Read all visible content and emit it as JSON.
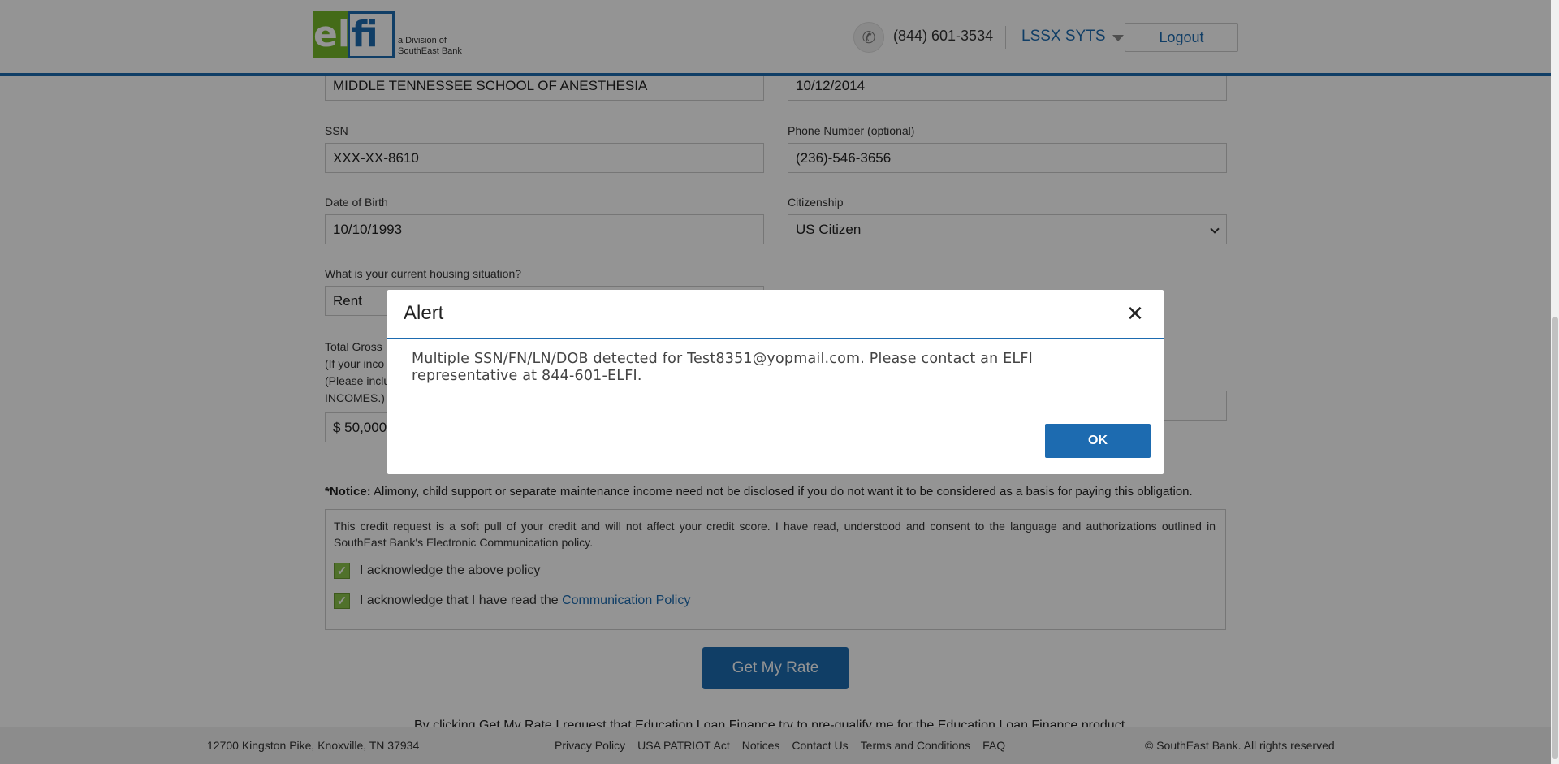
{
  "header": {
    "logo": {
      "part1": "el",
      "part2": "fi",
      "subtitle_line1": "a Division of",
      "subtitle_line2": "SouthEast Bank"
    },
    "phone": "(844) 601-3534",
    "user_name": "LSSX SYTS",
    "logout_label": "Logout"
  },
  "form": {
    "school_value": "MIDDLE TENNESSEE SCHOOL OF ANESTHESIA",
    "date_value": "10/12/2014",
    "ssn_label": "SSN",
    "ssn_value": "XXX-XX-8610",
    "phone_label": "Phone Number (optional)",
    "phone_value": "(236)-546-3656",
    "dob_label": "Date of Birth",
    "dob_value": "10/10/1993",
    "citizenship_label": "Citizenship",
    "citizenship_value": "US Citizen",
    "housing_label": "What is your current housing situation?",
    "housing_value": "Rent",
    "income_label_line1": "Total Gross I",
    "income_label_line2": "(If your inco",
    "income_label_line3": "(Please inclu",
    "income_label_line4": "INCOMES.)",
    "income_value": "$ 50,000"
  },
  "notice": {
    "prefix": "*Notice:",
    "text": " Alimony, child support or separate maintenance income need not be disclosed if you do not want it to be considered as a basis for paying this obligation."
  },
  "policy": {
    "text": "This credit request is a soft pull of your credit and will not affect your credit score. I have read, understood and consent to the language and authorizations outlined in SouthEast Bank's Electronic Communication policy.",
    "ack1": "I acknowledge the above policy",
    "ack2_prefix": "I acknowledge that I have read the",
    "ack2_link": "Communication Policy"
  },
  "get_rate_label": "Get My Rate",
  "disclaimer": "By clicking Get My Rate I request that Education Loan Finance try to pre-qualify me for the Education Loan Finance product",
  "footer": {
    "address": "12700 Kingston Pike, Knoxville, TN 37934",
    "links": [
      "Privacy Policy",
      "USA PATRIOT Act",
      "Notices",
      "Contact Us",
      "Terms and Conditions",
      "FAQ"
    ],
    "copyright": "© SouthEast Bank. All rights reserved"
  },
  "modal": {
    "title": "Alert",
    "close_glyph": "✕",
    "message": "Multiple SSN/FN/LN/DOB detected for Test8351@yopmail.com. Please contact an ELFI representative at 844-601-ELFI.",
    "ok_label": "OK"
  },
  "colors": {
    "brand_blue": "#1d6bb0",
    "brand_green": "#76b82a"
  }
}
